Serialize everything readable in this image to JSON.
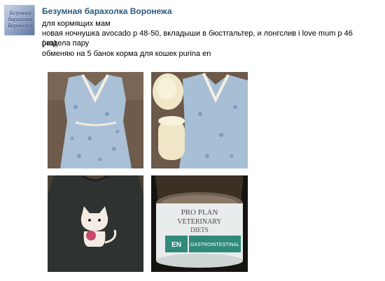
{
  "post": {
    "author": {
      "name": "Безумная барахолка Воронежа",
      "avatar_text": "Безумная барахолка Воронежа"
    },
    "text_lines": [
      "для кормящих мам",
      "новая ночнушка avocado р 48-50, вкладыши в бюстгальтер, и лонгслив i love mum р 46 (надела пару",
      "раз)",
      "обменяю на 5 банок корма для кошек purina en"
    ],
    "photos": [
      {
        "name": "nightgown-photo"
      },
      {
        "name": "nightgown-and-pads-photo"
      },
      {
        "name": "longsleeve-cat-photo"
      },
      {
        "name": "cat-food-can-photo",
        "can_label": {
          "brand": "PRO PLAN",
          "line1": "VETERINARY",
          "line2": "DIETS",
          "code": "EN",
          "diet": "GASTROINTESTINAL"
        }
      }
    ]
  }
}
